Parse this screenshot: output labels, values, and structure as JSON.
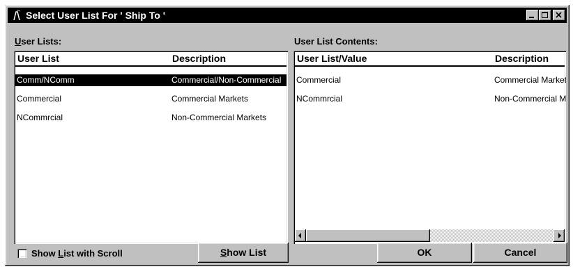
{
  "window": {
    "title": "Select User List For ' Ship To '",
    "icon": "app-icon",
    "controls": [
      "minimize-icon",
      "maximize-icon",
      "close-icon"
    ]
  },
  "user_lists": {
    "label_prefix": "U",
    "label_rest": "ser Lists:",
    "columns": [
      "User List",
      "Description"
    ],
    "rows": [
      {
        "name": "Comm/NComm",
        "description": "Commercial/Non-Commercial",
        "selected": true
      },
      {
        "name": "Commercial",
        "description": "Commercial Markets",
        "selected": false
      },
      {
        "name": "NCommrcial",
        "description": "Non-Commercial Markets",
        "selected": false
      }
    ]
  },
  "contents": {
    "label": "User List Contents:",
    "columns": [
      "User List/Value",
      "Description"
    ],
    "rows": [
      {
        "value": "Commercial",
        "description": "Commercial Markets"
      },
      {
        "value": "NCommrcial",
        "description": "Non-Commercial Markets"
      }
    ]
  },
  "footer": {
    "checkbox_pre": "Show ",
    "checkbox_u": "L",
    "checkbox_post": "ist with Scroll",
    "checkbox_checked": false,
    "show_list_u": "S",
    "show_list_rest": "how List",
    "ok": "OK",
    "cancel": "Cancel"
  }
}
